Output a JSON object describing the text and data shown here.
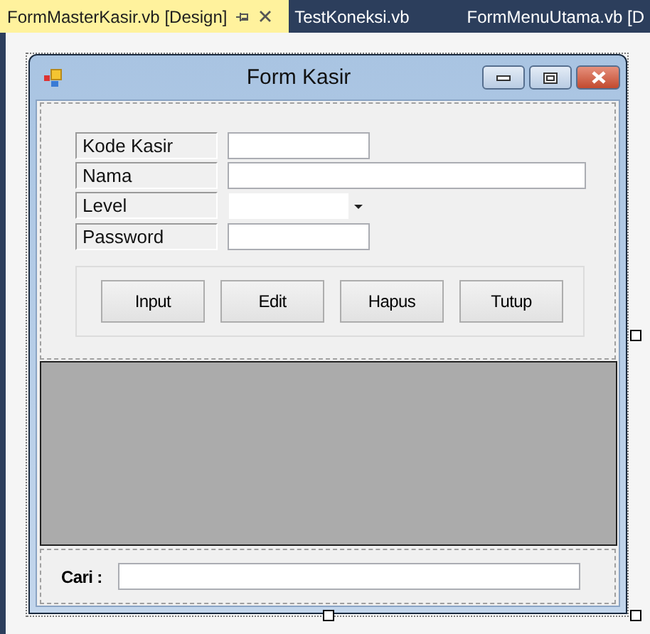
{
  "tabs": [
    {
      "label": "FormMasterKasir.vb [Design]",
      "selected": true
    },
    {
      "label": "TestKoneksi.vb",
      "selected": false
    },
    {
      "label": "FormMenuUtama.vb [D",
      "selected": false
    }
  ],
  "window": {
    "title": "Form Kasir"
  },
  "fields": [
    {
      "label": "Kode Kasir",
      "kind": "short-text"
    },
    {
      "label": "Nama",
      "kind": "long-text"
    },
    {
      "label": "Level",
      "kind": "combo"
    },
    {
      "label": "Password",
      "kind": "short-text"
    }
  ],
  "buttons": [
    "Input",
    "Edit",
    "Hapus",
    "Tutup"
  ],
  "search": {
    "label": "Cari :"
  }
}
